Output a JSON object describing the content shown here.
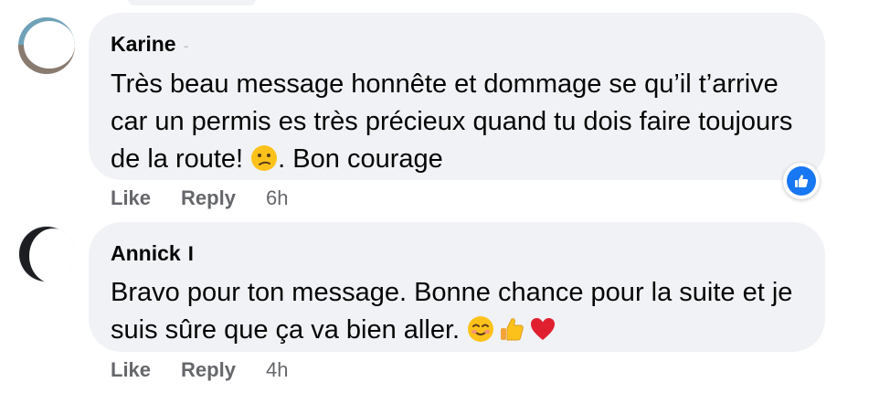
{
  "comments": [
    {
      "author": "Karine",
      "author_tail": "‐",
      "text": "Très beau message honnête et dommage se qu’il t’arrive car un permis es très précieux quand tu dois faire toujours de la route!",
      "text_after_emoji": ". Bon courage",
      "emojis": [
        "confused-face-icon"
      ],
      "actions": {
        "like": "Like",
        "reply": "Reply",
        "time": "6h"
      },
      "reaction": "like-reaction-icon"
    },
    {
      "author": "Annick",
      "author_tail": "I",
      "text": "Bravo pour ton message. Bonne chance pour la suite et je suis sûre que ça va bien aller.",
      "emojis": [
        "smiling-face-icon",
        "thumbs-up-icon",
        "red-heart-icon"
      ],
      "actions": {
        "like": "Like",
        "reply": "Reply",
        "time": "4h"
      }
    }
  ],
  "colors": {
    "bubble": "#f0f2f5",
    "action_text": "#65676b",
    "reaction_blue": "#1877f2"
  }
}
